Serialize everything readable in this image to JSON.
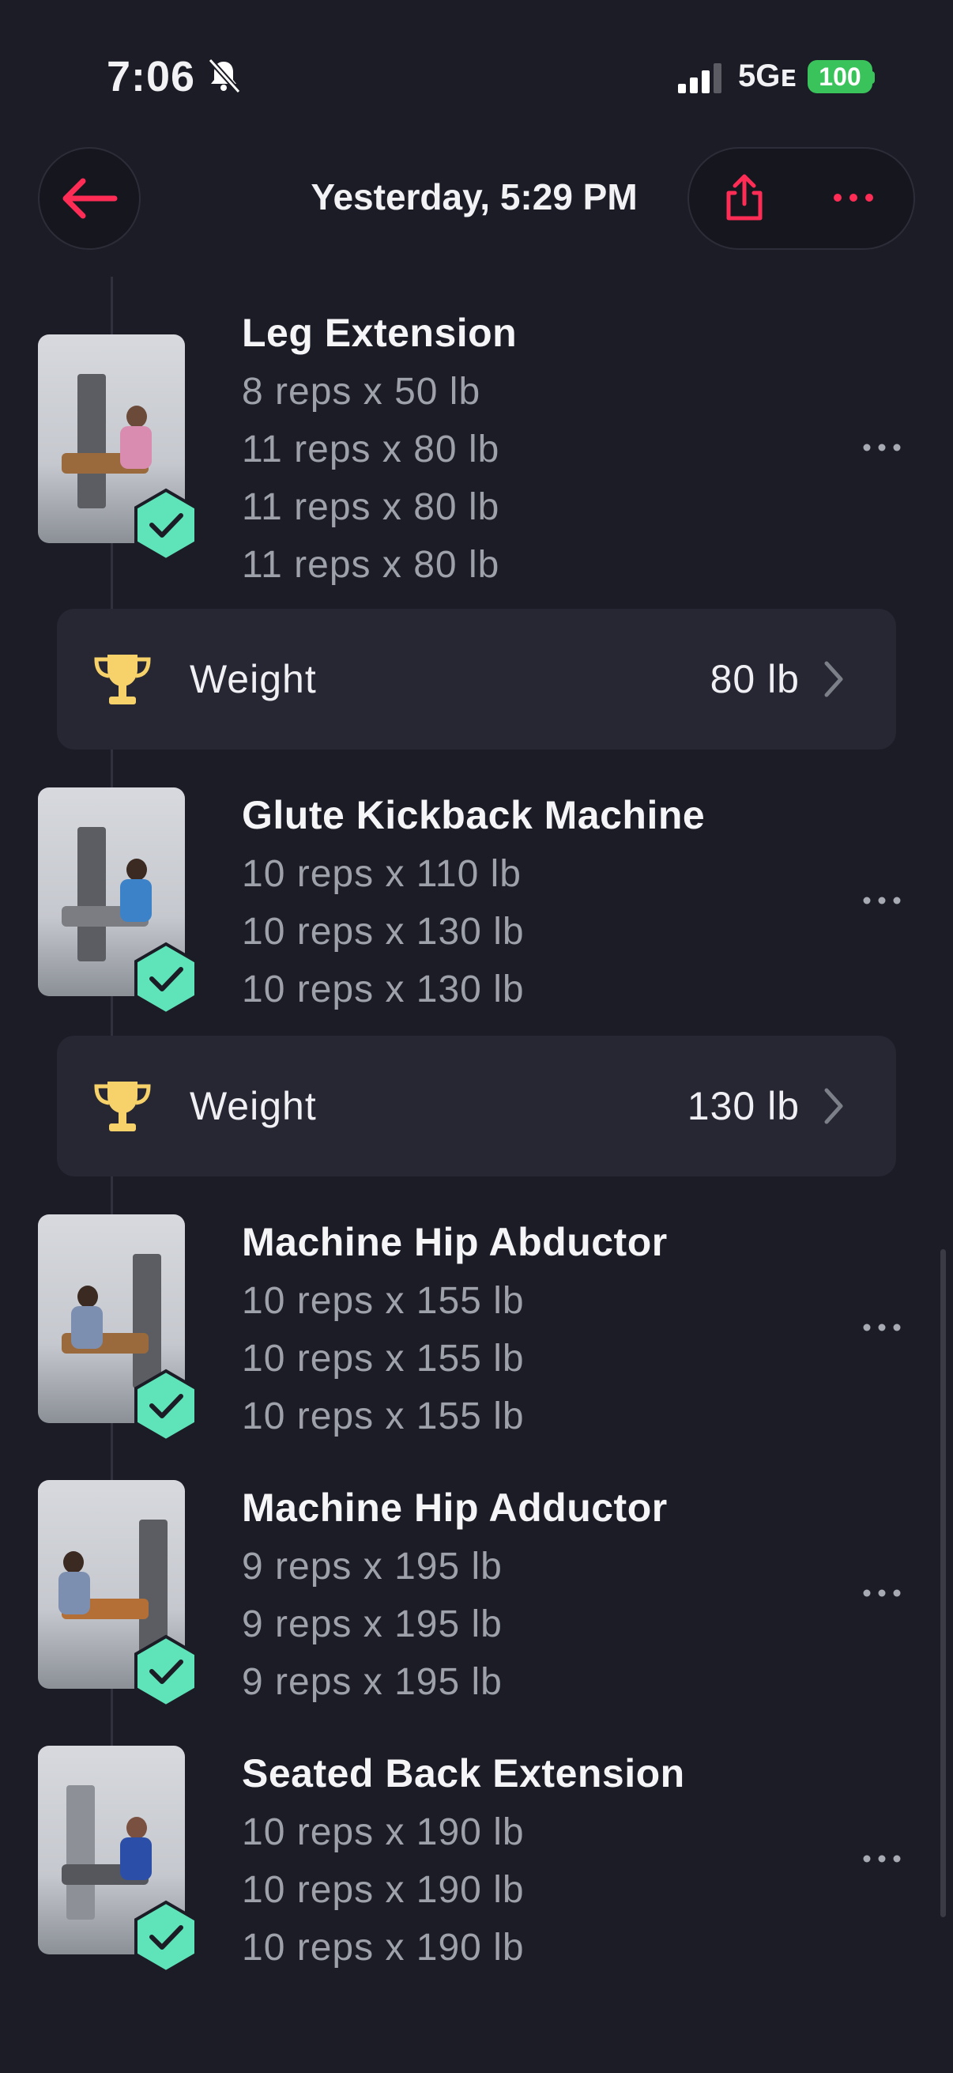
{
  "status_bar": {
    "time": "7:06",
    "network": "5Gᴇ",
    "battery": "100"
  },
  "header": {
    "title": "Yesterday, 5:29 PM"
  },
  "colors": {
    "accent": "#ff2d55",
    "badge": "#5fe3b8",
    "trophy": "#f7d26a",
    "background": "#1b1c26",
    "card": "#262733"
  },
  "exercises": [
    {
      "name": "Leg Extension",
      "sets": [
        "8 reps x 50 lb",
        "11 reps x 80 lb",
        "11 reps x 80 lb",
        "11 reps x 80 lb"
      ]
    },
    {
      "name": "Glute Kickback Machine",
      "sets": [
        "10 reps x 110 lb",
        "10 reps x 130 lb",
        "10 reps x 130 lb"
      ]
    },
    {
      "name": "Machine Hip Abductor",
      "sets": [
        "10 reps x 155 lb",
        "10 reps x 155 lb",
        "10 reps x 155 lb"
      ]
    },
    {
      "name": "Machine Hip Adductor",
      "sets": [
        "9 reps x 195 lb",
        "9 reps x 195 lb",
        "9 reps x 195 lb"
      ]
    },
    {
      "name": "Seated Back Extension",
      "sets": [
        "10 reps x 190 lb",
        "10 reps x 190 lb",
        "10 reps x 190 lb"
      ]
    }
  ],
  "records": [
    {
      "label": "Weight",
      "value": "80 lb"
    },
    {
      "label": "Weight",
      "value": "130 lb"
    }
  ]
}
